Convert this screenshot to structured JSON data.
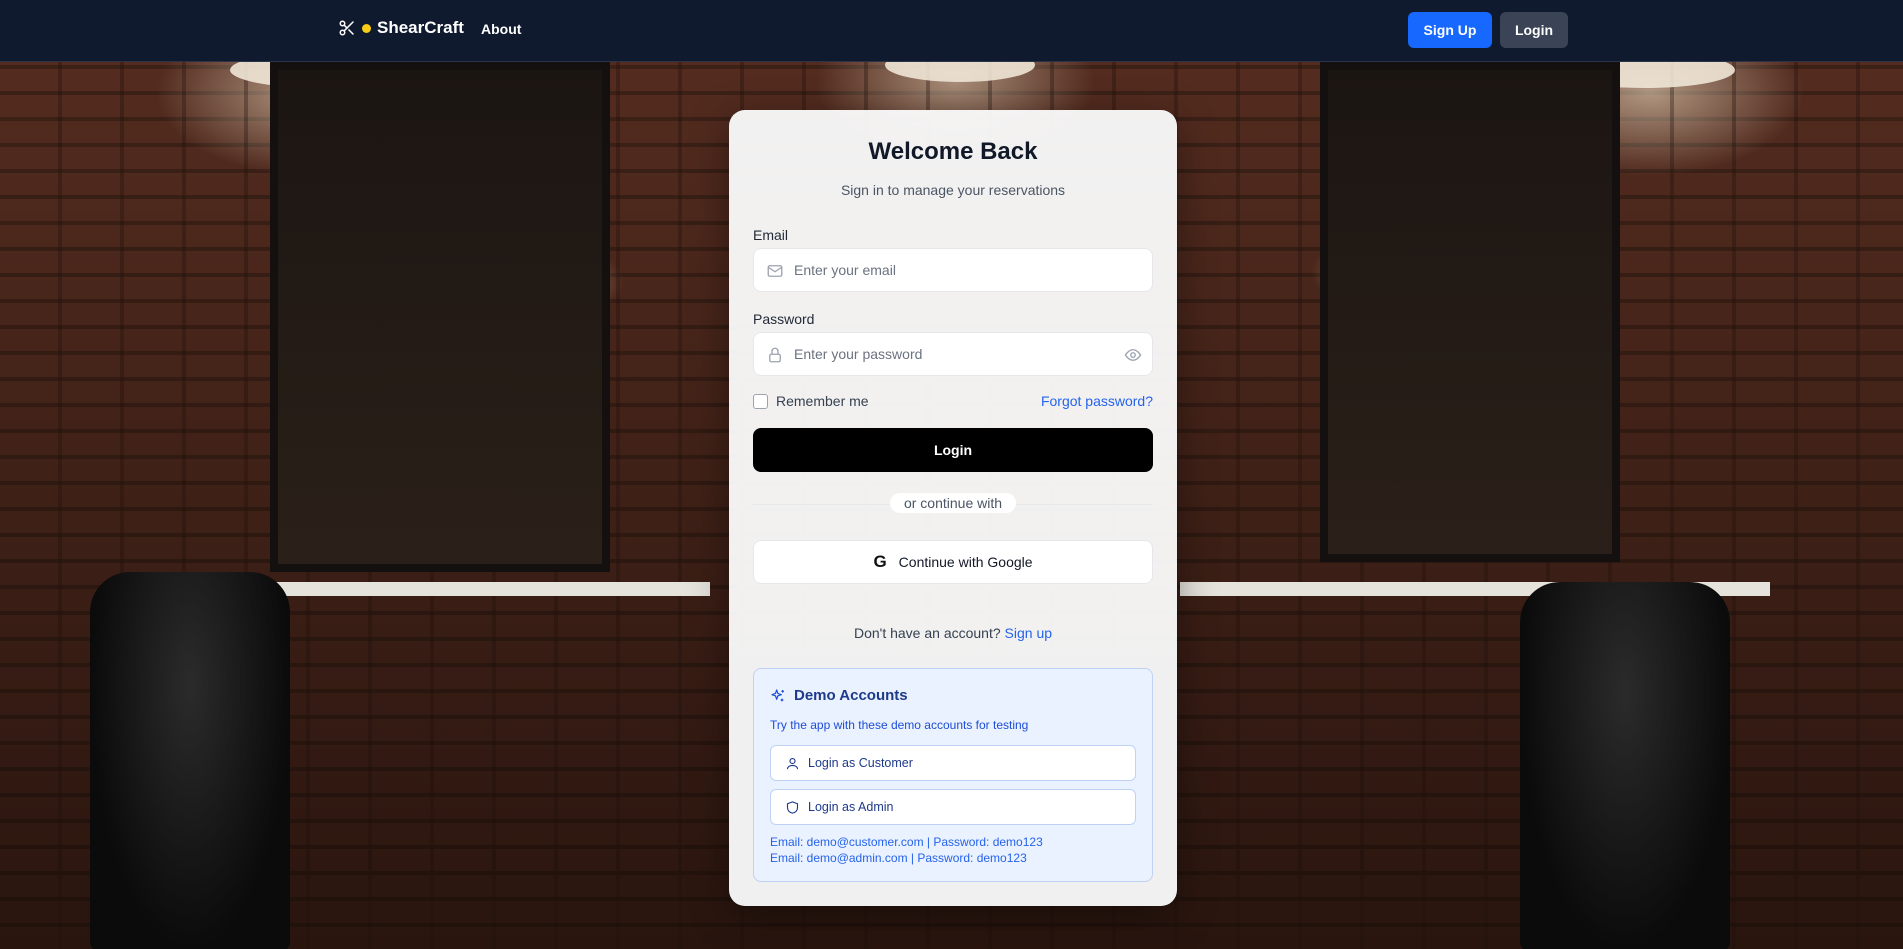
{
  "navbar": {
    "brand": "ShearCraft",
    "about": "About",
    "signup": "Sign Up",
    "login": "Login"
  },
  "card": {
    "title": "Welcome Back",
    "subtitle": "Sign in to manage your reservations",
    "email_label": "Email",
    "email_placeholder": "Enter your email",
    "password_label": "Password",
    "password_placeholder": "Enter your password",
    "remember": "Remember me",
    "forgot": "Forgot password?",
    "login_button": "Login",
    "divider": "or continue with",
    "google_button": "Continue with Google",
    "no_account": "Don't have an account?",
    "signup_link": "Sign up"
  },
  "demo": {
    "title": "Demo Accounts",
    "description": "Try the app with these demo accounts for testing",
    "customer_button": "Login as Customer",
    "admin_button": "Login as Admin",
    "customer_creds": "Email: demo@customer.com | Password: demo123",
    "admin_creds": "Email: demo@admin.com | Password: demo123"
  },
  "colors": {
    "navbar": "#0f1a2e",
    "primary": "#1668ff",
    "accent_dot": "#facc15",
    "link": "#2563eb"
  }
}
